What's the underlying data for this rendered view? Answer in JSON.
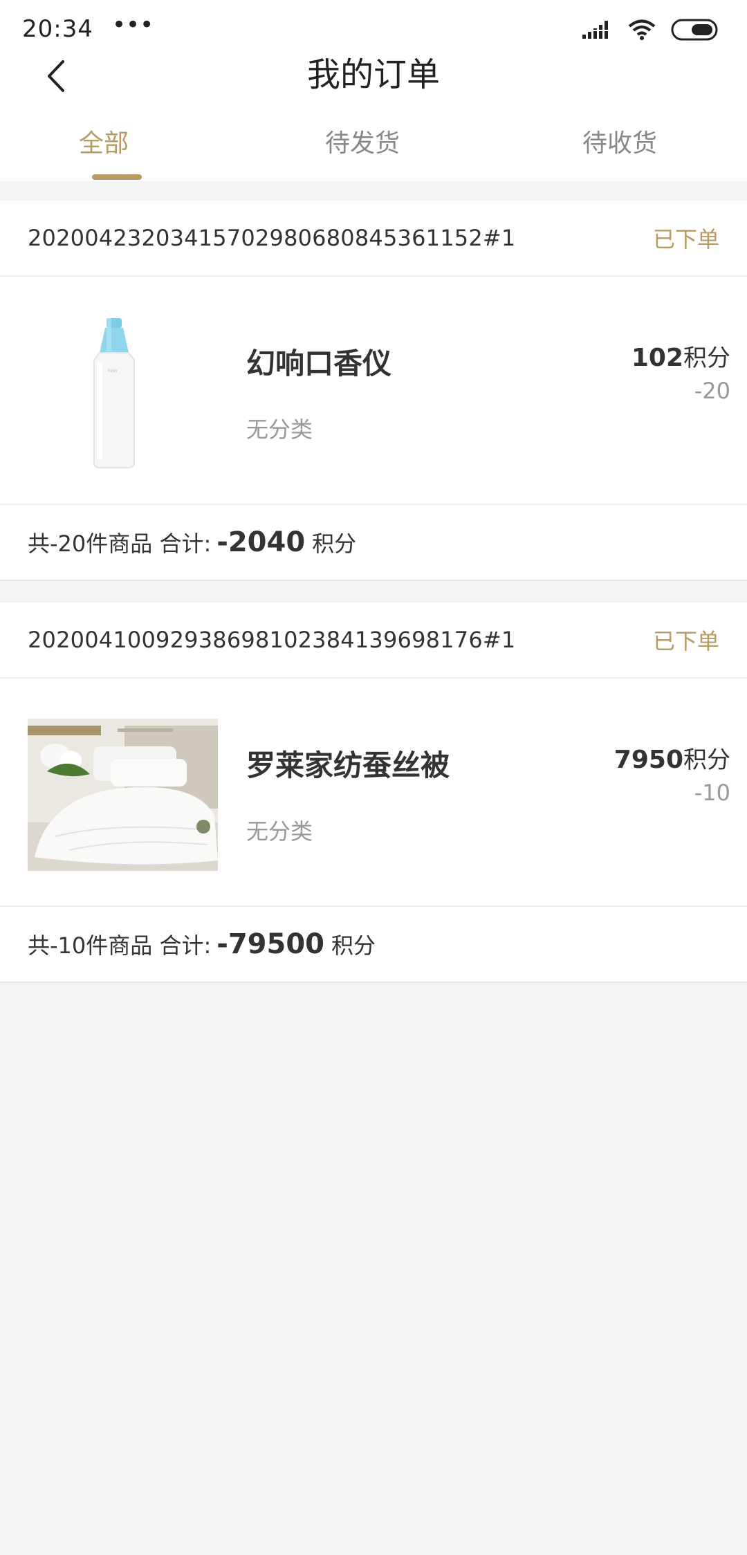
{
  "status_bar": {
    "time": "20:34",
    "dots": "•••"
  },
  "header": {
    "title": "我的订单"
  },
  "tabs": [
    {
      "label": "全部",
      "active": true
    },
    {
      "label": "待发货",
      "active": false
    },
    {
      "label": "待收货",
      "active": false
    }
  ],
  "colors": {
    "accent": "#b89a63",
    "background": "#f4f4f4"
  },
  "orders": [
    {
      "order_no": "20200423203415702980680845361152#1",
      "status": "已下单",
      "product_name": "幻响口香仪",
      "category": "无分类",
      "price_value": "102",
      "price_unit": "积分",
      "qty": "-20",
      "summary_prefix": "共-20件商品 合计:",
      "summary_total": "-2040",
      "summary_unit": "积分"
    },
    {
      "order_no": "20200410092938698102384139698176#1",
      "status": "已下单",
      "product_name": "罗莱家纺蚕丝被",
      "category": "无分类",
      "price_value": "7950",
      "price_unit": "积分",
      "qty": "-10",
      "summary_prefix": "共-10件商品 合计:",
      "summary_total": "-79500",
      "summary_unit": "积分"
    }
  ]
}
